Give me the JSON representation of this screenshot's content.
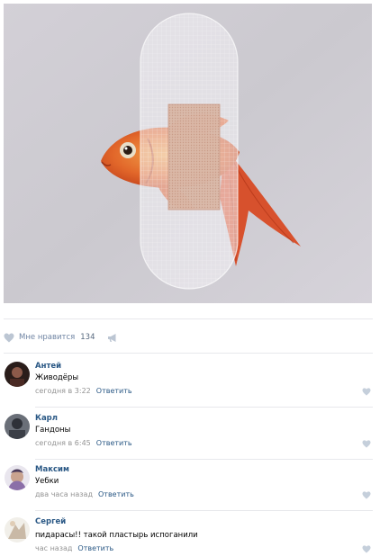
{
  "post": {
    "likes_label": "Мне нравится",
    "likes_count": "134",
    "reply_label": "Ответить"
  },
  "colors": {
    "link": "#2a5885",
    "meta": "#939393",
    "icon": "#bcc6d3",
    "divider": "#e7e8ec"
  },
  "icons": {
    "like": "heart-icon",
    "share": "megaphone-icon"
  },
  "comments": [
    {
      "author": "Антей",
      "text": "Живодёры",
      "time": "сегодня в 3:22"
    },
    {
      "author": "Карл",
      "text": "Гандоны",
      "time": "сегодня в 6:45"
    },
    {
      "author": "Максим",
      "text": "Уебки",
      "time": "два часа назад"
    },
    {
      "author": "Сергей",
      "text": "пидарасы!! такой пластырь испоганили",
      "time": "час назад"
    }
  ]
}
